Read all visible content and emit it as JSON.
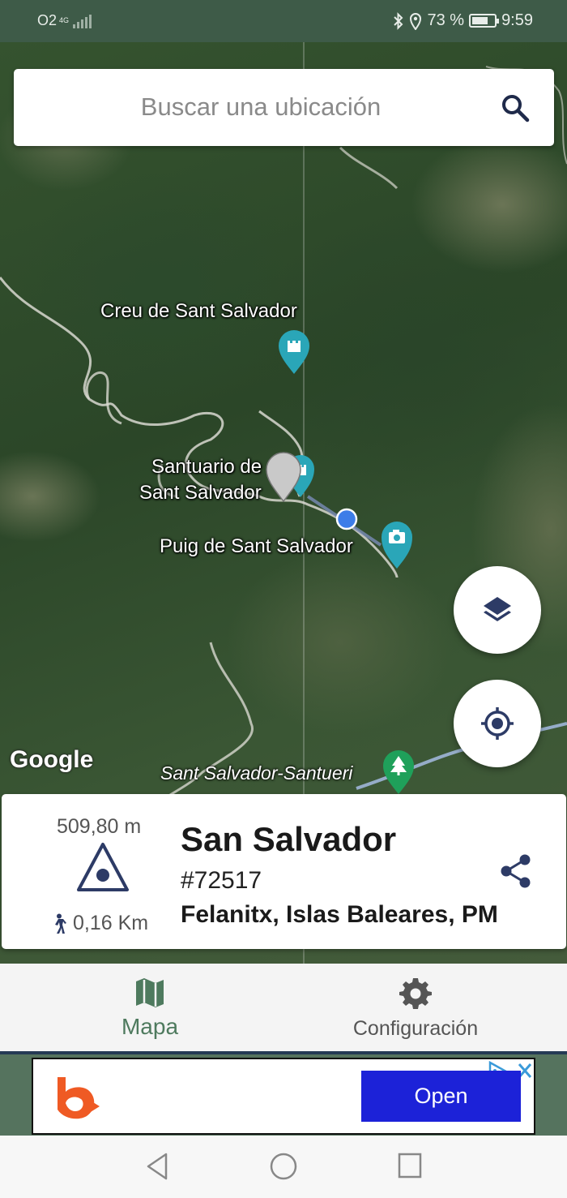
{
  "status_bar": {
    "carrier": "O2",
    "network": "4G",
    "battery": "73 %",
    "battery_level": 0.73,
    "time": "9:59"
  },
  "search": {
    "placeholder": "Buscar una ubicación"
  },
  "map": {
    "labels": {
      "creu": "Creu de Sant Salvador",
      "santuario_line1": "Santuario de",
      "santuario_line2": "Sant Salvador",
      "puig": "Puig de Sant Salvador",
      "road": "Sant Salvador-Santueri"
    },
    "attribution": "Google",
    "marker_color": "#2aa6b8",
    "tree_marker_color": "#1fa05a"
  },
  "info_card": {
    "elevation": "509,80 m",
    "distance": "0,16 Km",
    "name": "San Salvador",
    "id": "#72517",
    "location": "Felanitx, Islas Baleares, PM"
  },
  "bottom_nav": {
    "items": [
      {
        "label": "Mapa",
        "icon": "map-icon",
        "active": true
      },
      {
        "label": "Configuración",
        "icon": "gear-icon",
        "active": false
      }
    ],
    "active_color": "#4e7a5e"
  },
  "ad": {
    "button_label": "Open",
    "button_color": "#1c22d8"
  },
  "colors": {
    "accent": "#2d3b66",
    "status_bar": "#3e5b48"
  }
}
